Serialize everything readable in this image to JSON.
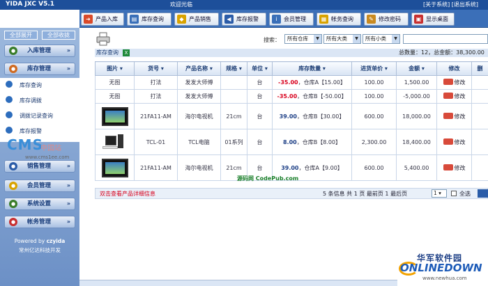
{
  "header": {
    "logo": "YIDA JXC V5.1",
    "welcome": "欢迎光临",
    "about": "[关于系统] [退出系统]"
  },
  "nav": [
    {
      "label": "产品入库",
      "icon": "arrow-icon",
      "color": "#d94a2a"
    },
    {
      "label": "库存查询",
      "icon": "book-icon",
      "color": "#3a6fb8"
    },
    {
      "label": "产品销售",
      "icon": "tag-icon",
      "color": "#d9a300"
    },
    {
      "label": "库存报警",
      "icon": "speaker-icon",
      "color": "#2b5ca8"
    },
    {
      "label": "会员管理",
      "icon": "member-icon",
      "color": "#3a6fb8"
    },
    {
      "label": "帐务查询",
      "icon": "ledger-icon",
      "color": "#d9a300"
    },
    {
      "label": "修改密码",
      "icon": "key-icon",
      "color": "#c98a20"
    },
    {
      "label": "显示桌面",
      "icon": "desktop-icon",
      "color": "#c83030"
    }
  ],
  "sidebar": {
    "expand_all": "全部展开",
    "collapse_all": "全部收拢",
    "menus": [
      {
        "label": "入库管理",
        "icon": "inbound-icon",
        "color": "#3a7d2a"
      },
      {
        "label": "库存管理",
        "icon": "inventory-icon",
        "color": "#d06a20"
      },
      {
        "label": "销售管理",
        "icon": "sales-icon",
        "color": "#2b5ca8"
      },
      {
        "label": "会员管理",
        "icon": "member-icon",
        "color": "#d9a300"
      },
      {
        "label": "系统设置",
        "icon": "settings-icon",
        "color": "#3a7d2a"
      },
      {
        "label": "帐务管理",
        "icon": "ledger-icon",
        "color": "#c83030"
      }
    ],
    "submenu": [
      "库存查询",
      "库存调拨",
      "调拨记录查询",
      "库存报警"
    ],
    "watermark": {
      "main": "CMS",
      "side": "中国站",
      "url": "www.cms1ee.com"
    },
    "powered_prefix": "Powered by",
    "powered_brand": "czyida",
    "company": "常州亿达科技开发"
  },
  "toolbar": {
    "search_label": "搜索：",
    "warehouse": "所有仓库",
    "category": "所有大类",
    "subcategory": "所有小类"
  },
  "panel": {
    "title": "库存查询",
    "summary": "总数量：12，总金额：38,300.00"
  },
  "table": {
    "headers": [
      "图片",
      "货号",
      "产品名称",
      "规格",
      "单位",
      "库存数量",
      "进货单价",
      "金额",
      "修改",
      "删"
    ],
    "rows": [
      {
        "image": "无图",
        "sku": "打法",
        "name": "发发大师傅",
        "spec": "",
        "unit": "台",
        "qty": "-35.00",
        "loc": "，仓库A【15.00】",
        "qty_neg": true,
        "price": "100.00",
        "amount": "1,500.00",
        "edit": "修改",
        "kind": "none"
      },
      {
        "image": "无图",
        "sku": "打法",
        "name": "发发大师傅",
        "spec": "",
        "unit": "台",
        "qty": "-35.00",
        "loc": "，仓库B【-50.00】",
        "qty_neg": true,
        "price": "100.00",
        "amount": "-5,000.00",
        "edit": "修改",
        "kind": "none"
      },
      {
        "image": "",
        "sku": "21FA11-AM",
        "name": "海尔电视机",
        "spec": "21cm",
        "unit": "台",
        "qty": "39.00",
        "loc": "，仓库B【30.00】",
        "qty_neg": false,
        "price": "600.00",
        "amount": "18,000.00",
        "edit": "修改",
        "kind": "tv"
      },
      {
        "image": "",
        "sku": "TCL-01",
        "name": "TCL电脑",
        "spec": "01系列",
        "unit": "台",
        "qty": "8.00",
        "loc": "，仓库B【8.00】",
        "qty_neg": false,
        "price": "2,300.00",
        "amount": "18,400.00",
        "edit": "修改",
        "kind": "pc"
      },
      {
        "image": "",
        "sku": "21FA11-AM",
        "name": "海尔电视机",
        "spec": "21cm",
        "unit": "台",
        "qty": "39.00",
        "loc": "，仓库A【9.00】",
        "qty_neg": false,
        "price": "600.00",
        "amount": "5,400.00",
        "edit": "修改",
        "kind": "tv"
      }
    ]
  },
  "pager": {
    "hint": "双击查看产品详细信息",
    "info": "5 条信息  共 1 页  最前页  1  最后页",
    "page": "1",
    "select_all": "全选"
  },
  "overlay": {
    "codepub": "源码网 CodePub.com"
  },
  "brand": {
    "cn": "华军软件园",
    "en": "ONLINEDOWN",
    "url": "www.newhua.com"
  }
}
